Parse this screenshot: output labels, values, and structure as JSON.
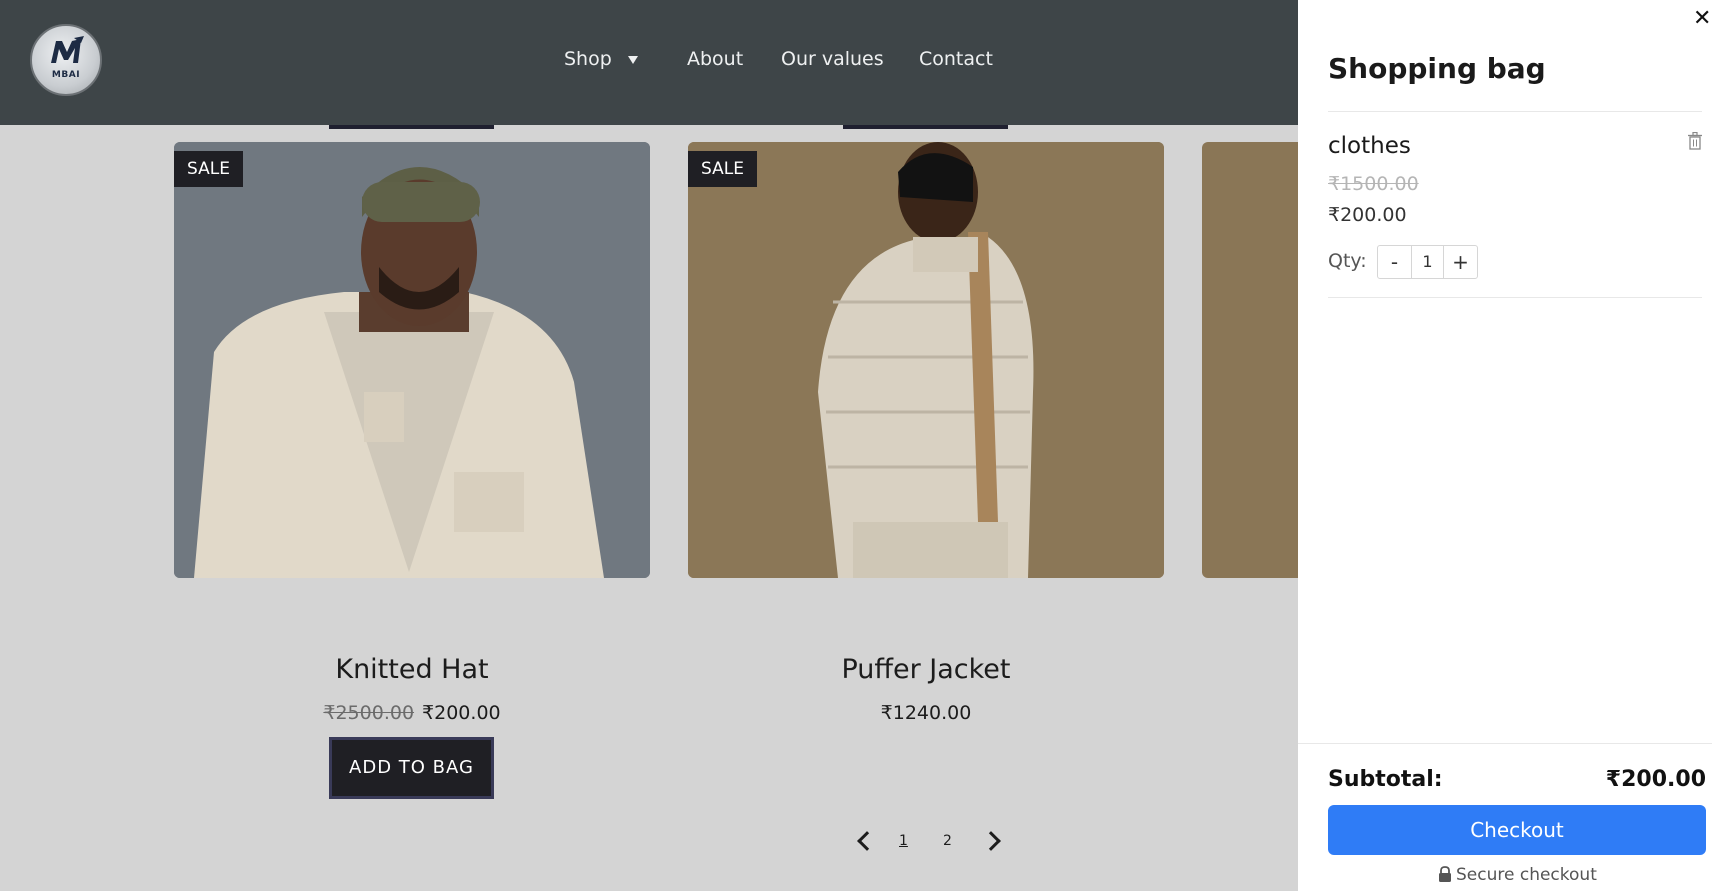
{
  "brand": {
    "logo_text": "MBAI",
    "logo_subtext": ""
  },
  "nav": {
    "shop": "Shop",
    "about": "About",
    "values": "Our values",
    "contact": "Contact"
  },
  "products": [
    {
      "badge": "SALE",
      "title": "Knitted Hat",
      "old_price": "₹2500.00",
      "price": "₹200.00",
      "button": "ADD TO BAG"
    },
    {
      "badge": "SALE",
      "title": "Puffer Jacket",
      "old_price": "",
      "price": "₹1240.00"
    }
  ],
  "pagination": {
    "page1": "1",
    "page2": "2"
  },
  "bag": {
    "title": "Shopping bag",
    "item": {
      "name": "clothes",
      "old_price": "₹1500.00",
      "price": "₹200.00",
      "qty_label": "Qty:",
      "minus": "-",
      "qty": "1",
      "plus": "+"
    },
    "subtotal_label": "Subtotal:",
    "subtotal_value": "₹200.00",
    "checkout": "Checkout",
    "secure": "Secure checkout"
  },
  "colors": {
    "header_bg": "#3e4548",
    "page_bg": "#d4d4d4",
    "accent": "#2f7cf6",
    "dark_button": "#1f1f24"
  }
}
